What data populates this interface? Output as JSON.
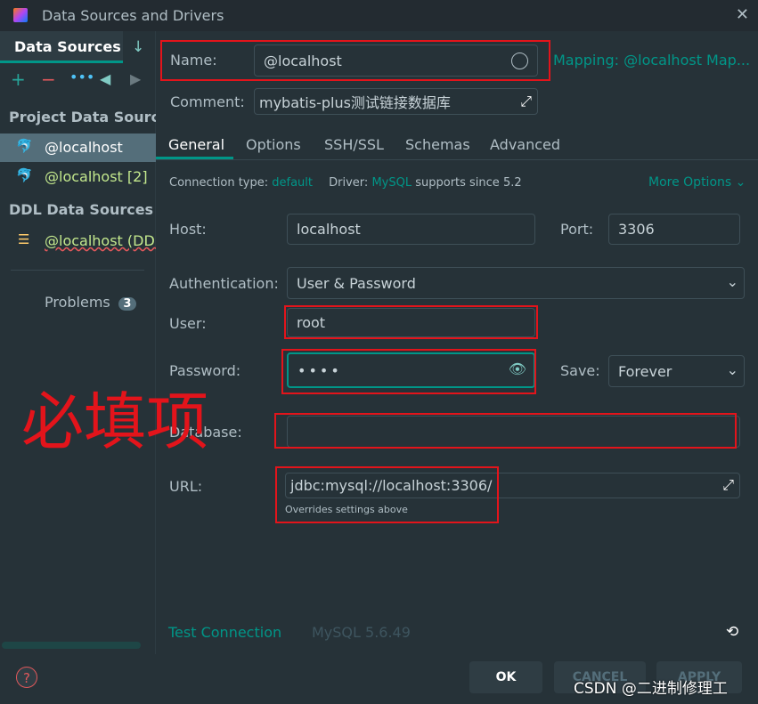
{
  "window": {
    "title": "Data Sources and Drivers"
  },
  "sidebar": {
    "tab": "Data Sources",
    "project_header": "Project Data Sources",
    "project_items": [
      {
        "label": "@localhost"
      },
      {
        "label": "@localhost [2]"
      }
    ],
    "ddl_header": "DDL Data Sources",
    "ddl_items": [
      {
        "label": "@localhost (DDL"
      }
    ],
    "problems_label": "Problems",
    "problems_count": "3"
  },
  "form": {
    "name_label": "Name:",
    "name_value": "@localhost",
    "mapping": "Mapping: @localhost Map...",
    "comment_label": "Comment:",
    "comment_value": "mybatis-plus测试链接数据库",
    "tabs": [
      "General",
      "Options",
      "SSH/SSL",
      "Schemas",
      "Advanced"
    ],
    "conn_type_label": "Connection type:",
    "conn_type_value": "default",
    "driver_label": "Driver:",
    "driver_value": "MySQL",
    "driver_suffix": "supports since 5.2",
    "more_options": "More Options",
    "host_label": "Host:",
    "host_value": "localhost",
    "port_label": "Port:",
    "port_value": "3306",
    "auth_label": "Authentication:",
    "auth_value": "User & Password",
    "user_label": "User:",
    "user_value": "root",
    "password_label": "Password:",
    "password_value": "••••",
    "save_label": "Save:",
    "save_value": "Forever",
    "database_label": "Database:",
    "database_value": "",
    "url_label": "URL:",
    "url_value": "jdbc:mysql://localhost:3306/",
    "url_hint": "Overrides settings above"
  },
  "footer": {
    "test_connection": "Test Connection",
    "version": "MySQL 5.6.49",
    "ok": "OK",
    "cancel": "CANCEL",
    "apply": "APPLY"
  },
  "annotation": "必填项",
  "watermark": "CSDN @二进制修理工",
  "colors": {
    "accent": "#009688",
    "background": "#263238",
    "annotation": "#e3141b"
  }
}
